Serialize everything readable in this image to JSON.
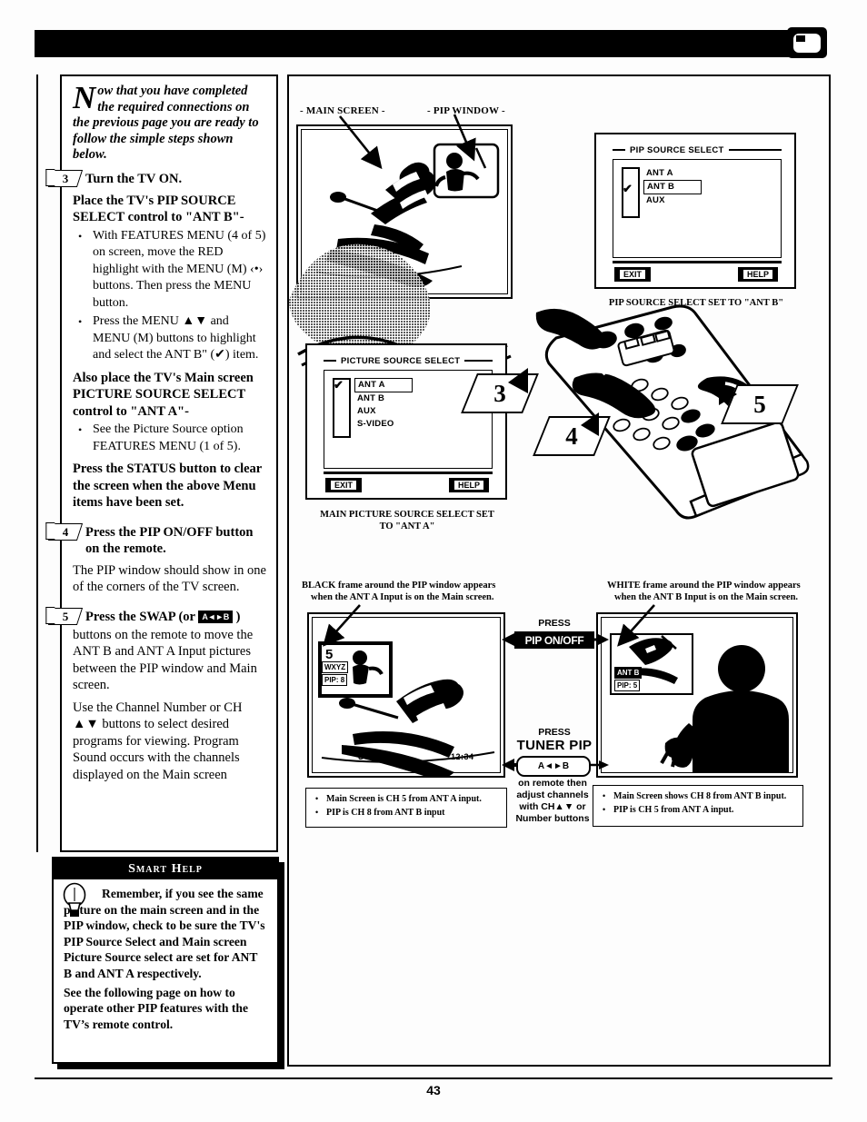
{
  "page": {
    "number": "43",
    "header_icon": "pip-tv-icon"
  },
  "left_column": {
    "intro": {
      "dropcap": "N",
      "text": "ow that you have completed the required connections on the previous page you are ready to follow the simple steps shown below."
    },
    "steps": [
      {
        "number": "3",
        "title": "Turn the TV ON.",
        "paragraphs": [
          "Place the TV's PIP SOURCE SELECT control to \"ANT B\"-"
        ],
        "bullets": [
          "With FEATURES MENU (4 of 5) on screen, move the RED highlight with the MENU (M) ‹•› buttons. Then press the MENU button.",
          "Press the MENU ▲▼ and MENU (M) buttons to highlight and select the ANT B\" (✔) item."
        ],
        "paragraphs2": [
          "Also place the TV's Main screen PICTURE SOURCE SELECT control to \"ANT A\"-"
        ],
        "bullets2": [
          "See the Picture Source option FEATURES MENU (1 of 5)."
        ],
        "paragraphs3": [
          "Press the STATUS button to clear the screen when the above Menu items have been set."
        ]
      },
      {
        "number": "4",
        "title": "Press the PIP ON/OFF button on the remote.",
        "paragraphs": [
          "The PIP window should show in one of the corners of the TV screen."
        ]
      },
      {
        "number": "5",
        "title_pre": "Press the SWAP (or",
        "title_key": "A◄►B",
        "title_post": ")",
        "paragraphs": [
          "buttons on the remote to move the ANT B and ANT A Input pictures between the PIP window and Main screen.",
          "Use the Channel Number or CH ▲▼ buttons to select desired programs for viewing. Program Sound occurs with the channels displayed on the Main screen"
        ]
      }
    ],
    "smart_help": {
      "title": "Smart Help",
      "icon": "lightbulb-icon",
      "paragraphs": [
        "Remember, if you see the same picture on the main screen and in the PIP window, check to be sure the TV's PIP Source Select and Main screen Picture Source select are set for ANT B and ANT A respectively.",
        "See the following page on how to operate other PIP features with the TV’s remote control."
      ]
    }
  },
  "right_panel": {
    "top_labels": {
      "main_screen": "- MAIN SCREEN -",
      "pip_window": "- PIP WINDOW -"
    },
    "pip_source_menu": {
      "title": "PIP SOURCE SELECT",
      "items": [
        "ANT A",
        "ANT B",
        "AUX"
      ],
      "selected": "ANT B",
      "checked": "ANT B",
      "exit_label": "EXIT",
      "help_label": "HELP",
      "caption": "PIP SOURCE SELECT SET TO \"ANT B\""
    },
    "picture_source_menu": {
      "title": "PICTURE SOURCE SELECT",
      "items": [
        "ANT A",
        "ANT B",
        "AUX",
        "S-VIDEO"
      ],
      "selected": "ANT A",
      "checked": "ANT A",
      "exit_label": "EXIT",
      "help_label": "HELP",
      "caption_line1": "MAIN PICTURE SOURCE SELECT SET",
      "caption_line2": "TO \"ANT A\""
    },
    "remote_callouts": [
      "3",
      "4",
      "5"
    ],
    "bottom": {
      "left_caption_line1": "BLACK frame around the PIP window appears",
      "left_caption_line2": "when the ANT A Input is on the Main screen.",
      "right_caption_line1": "WHITE frame around the PIP window appears",
      "right_caption_line2": "when the ANT B Input is on the Main screen.",
      "left_tv": {
        "channel": "5",
        "callsign": "WXYZ",
        "pip_label": "PIP: 8",
        "stereo": "STEREO",
        "time": "12:34"
      },
      "right_tv": {
        "pip_channel_label": "ANT B",
        "pip_label": "PIP: 5"
      },
      "center": {
        "press1": "PRESS",
        "button1": "PIP ON/OFF",
        "press2": "PRESS",
        "button2_name": "TUNER PIP",
        "button2_key": "A◄►B",
        "note_line1": "on remote then",
        "note_line2": "adjust channels",
        "note_line3": "with CH▲▼ or",
        "note_line4": "Number buttons"
      },
      "left_notes": [
        "Main Screen is CH 5 from ANT A input.",
        "PIP is CH 8 from ANT B input"
      ],
      "right_notes": [
        "Main Screen shows CH 8 from ANT B input.",
        "PIP is CH 5 from ANT A input."
      ]
    }
  },
  "colors": {
    "ink": "#000000",
    "paper": "#ffffff"
  }
}
